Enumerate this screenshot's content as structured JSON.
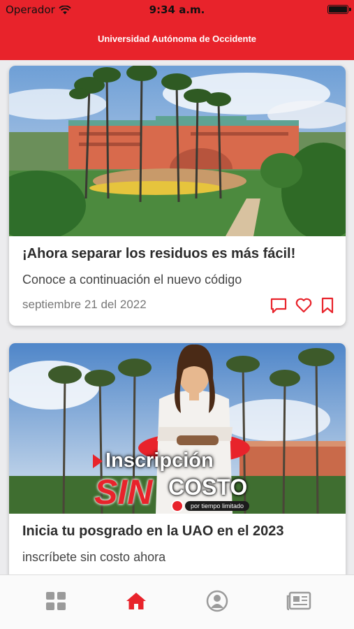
{
  "status_bar": {
    "carrier": "Operador",
    "time": "9:34 a.m."
  },
  "header": {
    "title": "Universidad Autónoma de Occidente"
  },
  "colors": {
    "brand_red": "#e8232b",
    "icon_gray": "#9a9a9a"
  },
  "cards": [
    {
      "title": "¡Ahora separar los residuos es más fácil!",
      "subtitle": "Conoce a continuación el nuevo código",
      "date": "septiembre 21 del 2022",
      "image": "campus-building-photo",
      "actions": [
        "comment-icon",
        "heart-icon",
        "bookmark-icon"
      ]
    },
    {
      "title": "Inicia tu posgrado en la UAO en el 2023",
      "subtitle": "inscríbete sin costo ahora",
      "image": "promo-banner",
      "banner": {
        "line1": "Inscripción",
        "sin": "SIN",
        "costo": "COSTO",
        "tag": "por tiempo limitado"
      }
    }
  ],
  "tab_bar": {
    "tabs": [
      {
        "icon": "grid-icon",
        "active": false
      },
      {
        "icon": "home-icon",
        "active": true
      },
      {
        "icon": "user-icon",
        "active": false
      },
      {
        "icon": "news-icon",
        "active": false
      }
    ]
  }
}
